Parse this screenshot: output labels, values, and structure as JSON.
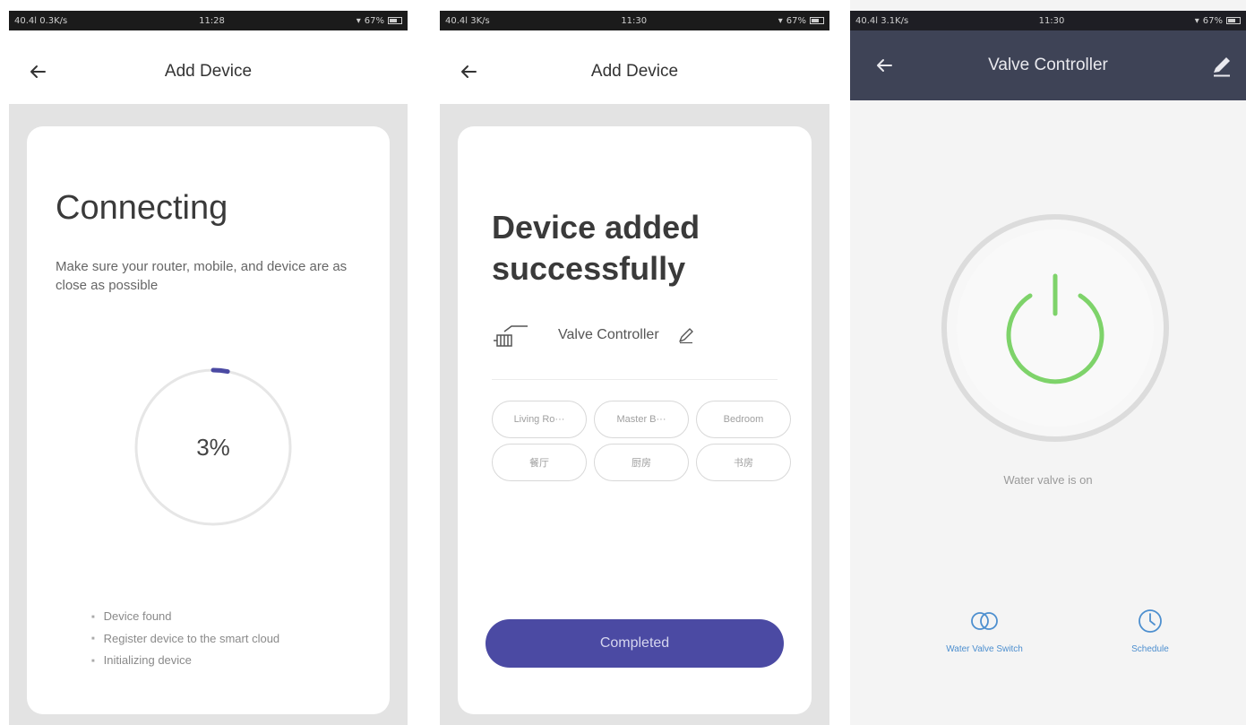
{
  "panels": {
    "connecting": {
      "status_bar": {
        "left": "40.4l 0.3K/s",
        "time": "11:28",
        "right": "67%"
      },
      "nav_title": "Add Device",
      "heading": "Connecting",
      "subtitle": "Make sure your router, mobile, and device are as close as possible",
      "progress_label": "3%",
      "progress_value": 0.03,
      "steps": [
        "Device found",
        "Register device to the smart cloud",
        "Initializing device"
      ]
    },
    "added": {
      "status_bar": {
        "left": "40.4l 3K/s",
        "time": "11:30",
        "right": "67%"
      },
      "nav_title": "Add Device",
      "heading": "Device added successfully",
      "device_name": "Valve Controller",
      "rooms": [
        "Living Ro···",
        "Master B···",
        "Bedroom",
        "餐厅",
        "厨房",
        "书房"
      ],
      "button_label": "Completed"
    },
    "controller": {
      "status_bar": {
        "left": "40.4l 3.1K/s",
        "time": "11:30",
        "right": "67%"
      },
      "nav_title": "Valve Controller",
      "status_text": "Water valve is on",
      "actions": [
        {
          "label": "Water Valve Switch",
          "icon": "toggle-icon"
        },
        {
          "label": "Schedule",
          "icon": "clock-icon"
        }
      ]
    }
  },
  "colors": {
    "accent": "#4b4aa3",
    "header_dark": "#3e4356",
    "power_green": "#7ed36a",
    "link_blue": "#4d8fcf",
    "card_bg": "#e3e3e3"
  }
}
